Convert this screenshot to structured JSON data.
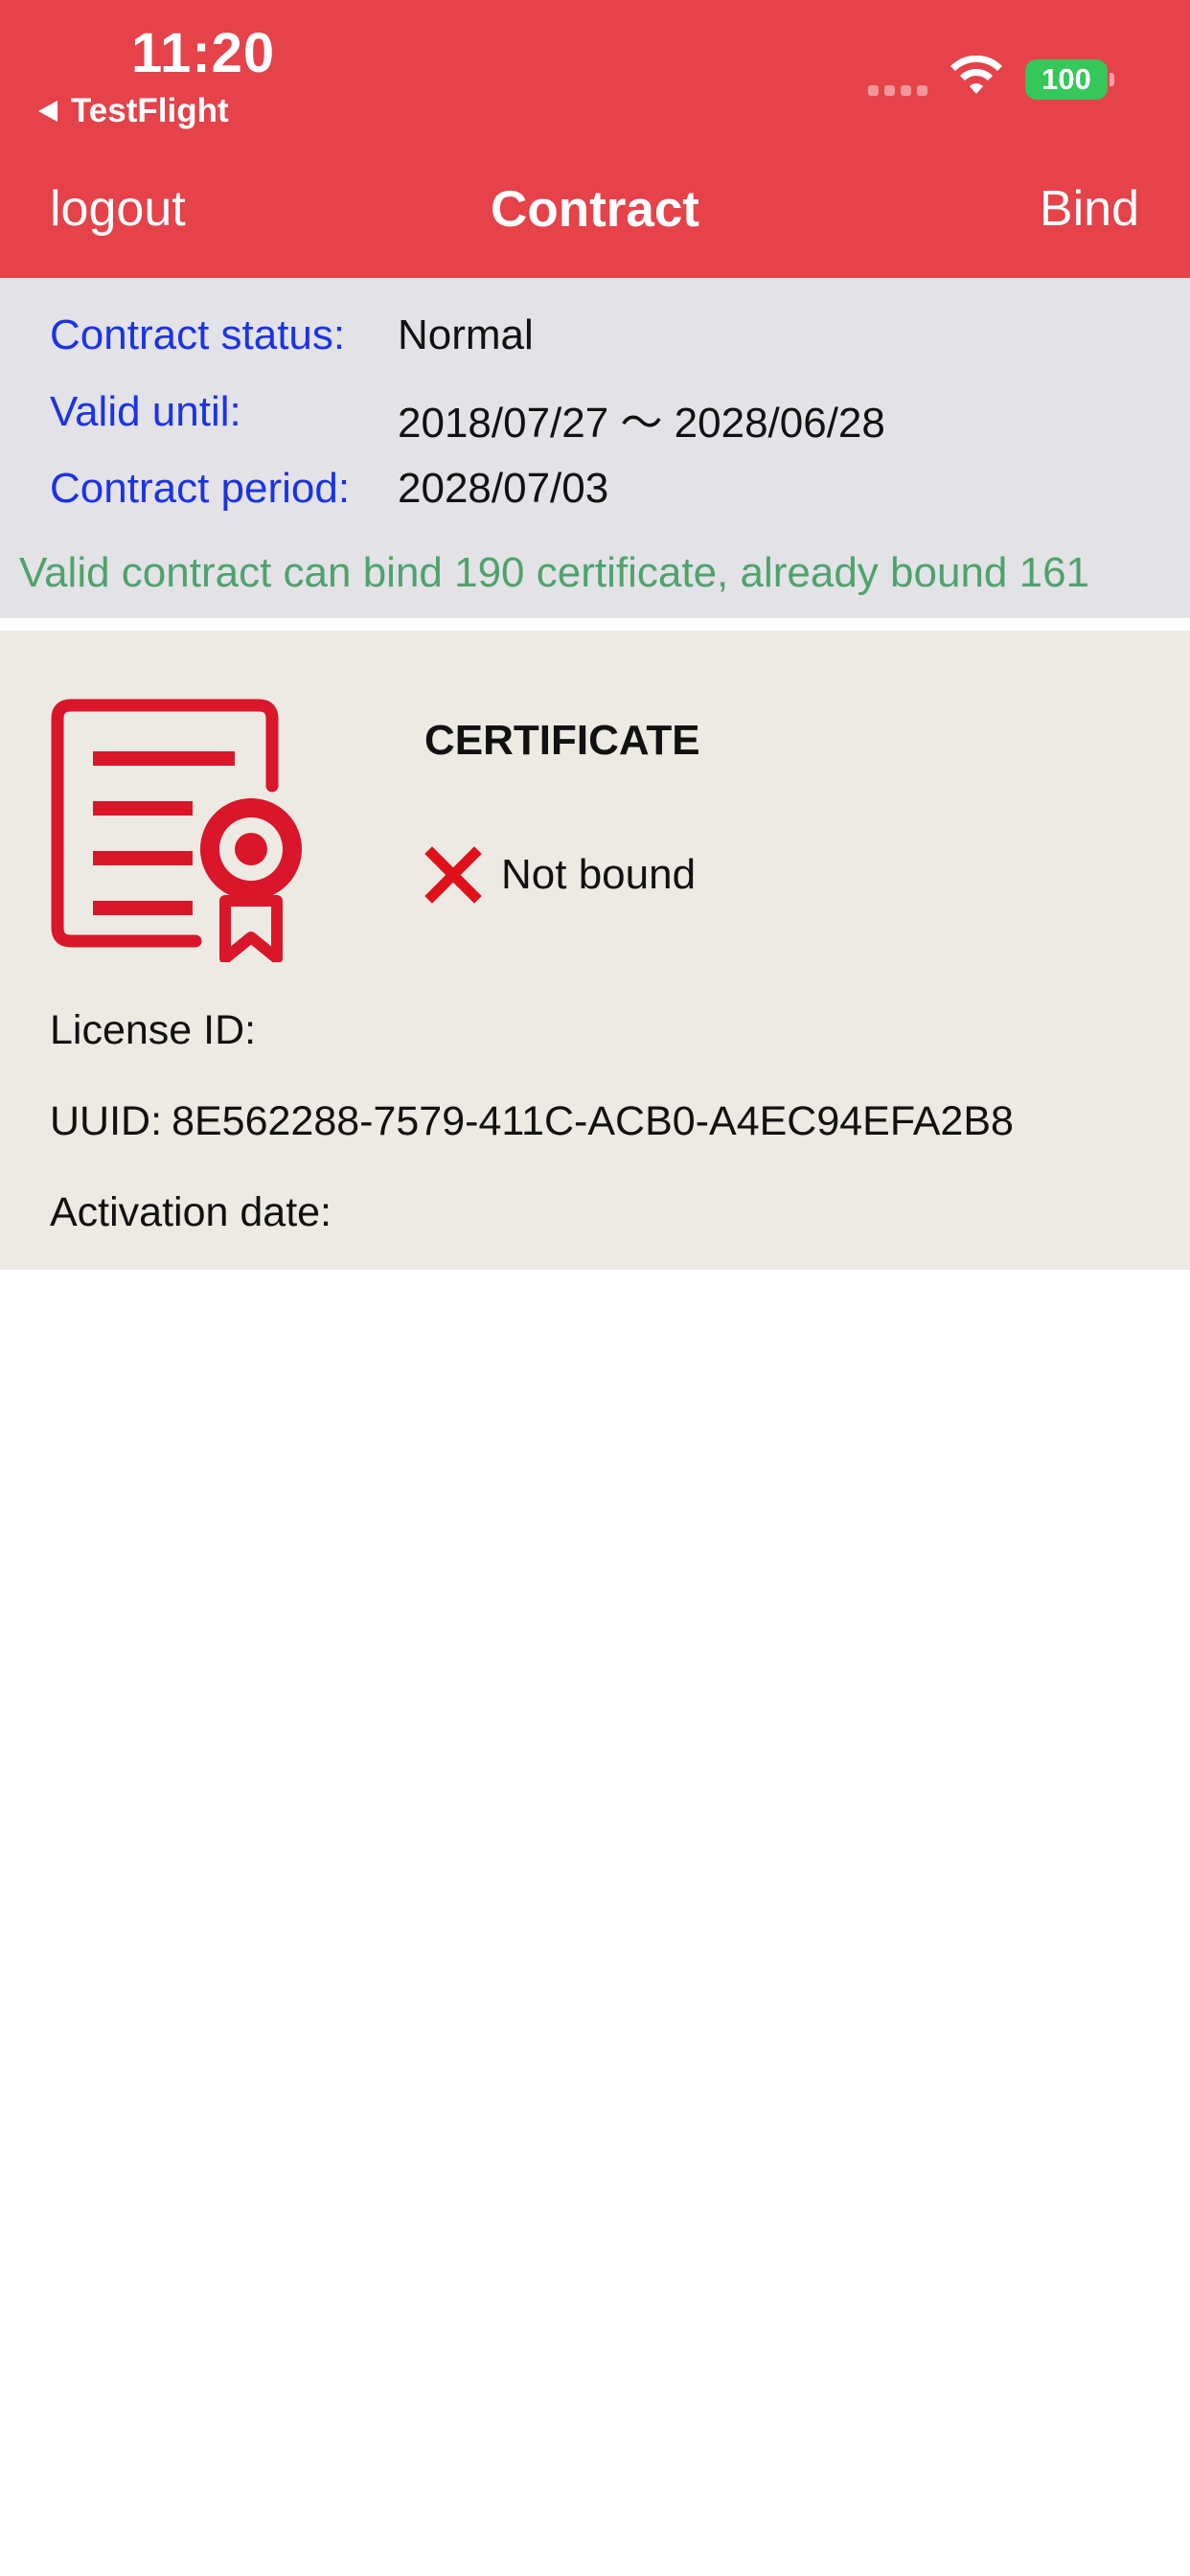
{
  "status_bar": {
    "time": "11:20",
    "back_app": "TestFlight",
    "battery": "100",
    "wifi_icon": "wifi-icon",
    "signal_icon": "cellular-signal-icon"
  },
  "nav": {
    "left_label": "logout",
    "title": "Contract",
    "right_label": "Bind"
  },
  "contract": {
    "status_label": "Contract status:",
    "status_value": "Normal",
    "valid_label": "Valid until:",
    "valid_value": "2018/07/27 〜 2028/06/28",
    "period_label": "Contract period:",
    "period_value": "2028/07/03",
    "note": "Valid contract can bind 190 certificate, already bound 161"
  },
  "certificate": {
    "icon": "certificate-icon",
    "title": "CERTIFICATE",
    "status_icon": "cross-icon",
    "status": "Not bound",
    "license_label": "License ID:",
    "license_value": "",
    "uuid_label": "UUID:",
    "uuid_value": "8E562288-7579-411C-ACB0-A4EC94EFA2B8",
    "activation_label": "Activation date:",
    "activation_value": ""
  },
  "colors": {
    "header_bg": "#e5424a",
    "label_blue": "#1b33e6",
    "note_green": "#4ea26e",
    "battery_green": "#35c759",
    "cert_red": "#d9162a",
    "info_bg": "#e3e2e6",
    "card_bg": "#edeae4"
  }
}
